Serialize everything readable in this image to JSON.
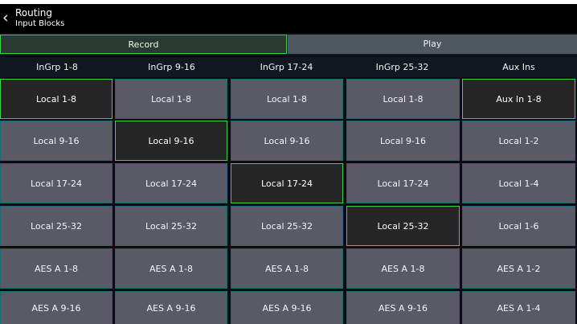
{
  "header": {
    "back_icon": "‹",
    "title": "Routing",
    "subtitle": "Input Blocks"
  },
  "modes": {
    "record": "Record",
    "play": "Play"
  },
  "columns": [
    "InGrp 1-8",
    "InGrp 9-16",
    "InGrp 17-24",
    "InGrp 25-32",
    "Aux Ins"
  ],
  "grid": [
    [
      "Local 1-8",
      "Local 1-8",
      "Local 1-8",
      "Local 1-8",
      "Aux In 1-8"
    ],
    [
      "Local 9-16",
      "Local 9-16",
      "Local 9-16",
      "Local 9-16",
      "Local 1-2"
    ],
    [
      "Local 17-24",
      "Local 17-24",
      "Local 17-24",
      "Local 17-24",
      "Local 1-4"
    ],
    [
      "Local 25-32",
      "Local 25-32",
      "Local 25-32",
      "Local 25-32",
      "Local 1-6"
    ],
    [
      "AES A 1-8",
      "AES A 1-8",
      "AES A 1-8",
      "AES A 1-8",
      "AES A 1-2"
    ],
    [
      "AES A 9-16",
      "AES A 9-16",
      "AES A 9-16",
      "AES A 9-16",
      "AES A 1-4"
    ]
  ],
  "selected": [
    [
      0,
      0
    ],
    [
      1,
      1
    ],
    [
      2,
      2
    ],
    [
      3,
      3
    ],
    [
      0,
      4
    ]
  ],
  "colors": {
    "accent": "#39d44a",
    "cell": "#5a5a67",
    "cell_selected": "#262626",
    "cell_border": "#1a6a78"
  }
}
